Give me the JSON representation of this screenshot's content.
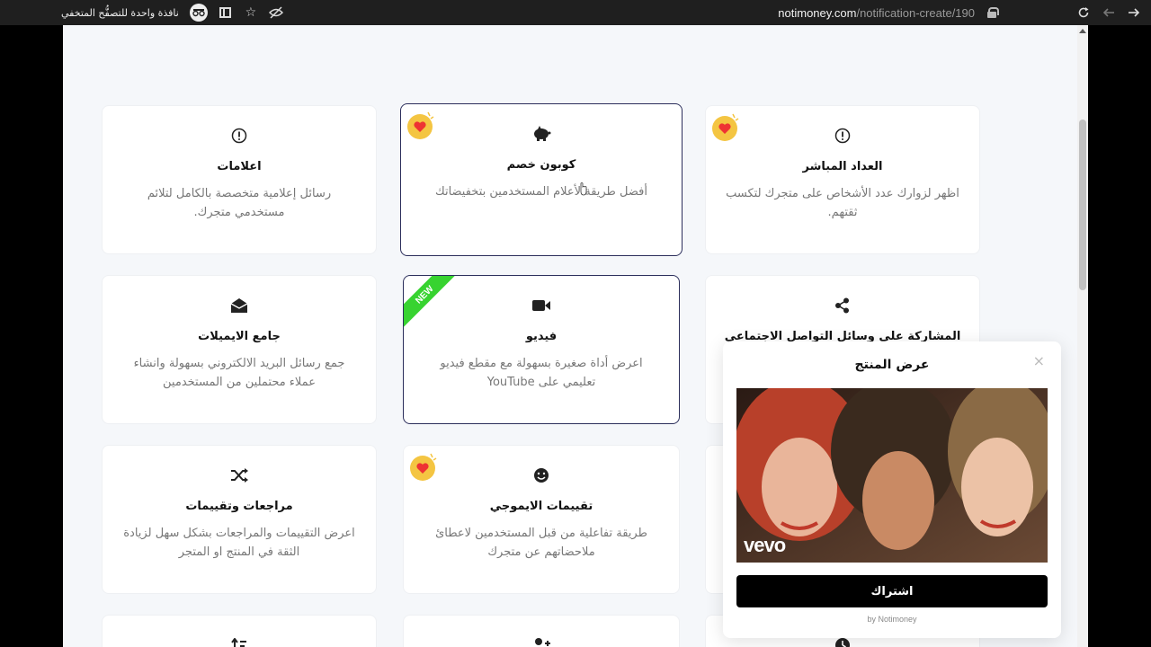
{
  "browser": {
    "url_domain": "notimoney.com",
    "url_path": "/notification-create/190",
    "incognito_label": "نافذة واحدة للتصفُّح المتخفي",
    "incognito_icon": "incognito-icon"
  },
  "cards": [
    {
      "title": "العداد المباشر",
      "desc": "اظهر لزوارك عدد الأشخاص على متجرك لتكسب ثقتهم.",
      "icon": "exclamation-circle-icon",
      "badge": "heart"
    },
    {
      "title": "كوبون خصم",
      "desc": "أفضل طريقة لأعلام المستخدمين بتخفيضاتك",
      "icon": "piggy-bank-icon",
      "badge": "heart",
      "selected": true
    },
    {
      "title": "اعلامات",
      "desc": "رسائل إعلامية متخصصة بالكامل لتلائم مستخدمي متجرك.",
      "icon": "exclamation-circle-icon"
    },
    {
      "title": "المشاركة على وسائل التواصل الاجتماعي",
      "desc": "",
      "icon": "share-icon"
    },
    {
      "title": "فيديو",
      "desc": "اعرض أداة صغيرة بسهولة مع مقطع فيديو تعليمي على YouTube",
      "icon": "video-icon",
      "badge": "new",
      "badge_text": "NEW",
      "selected": true
    },
    {
      "title": "جامع الايميلات",
      "desc": "جمع رسائل البريد الالكتروني بسهولة وانشاء عملاء محتملين من المستخدمين",
      "icon": "envelope-open-icon"
    },
    {
      "title": "تقييمات الايموجي",
      "desc": "طريقة تفاعلية من قبل المستخدمين لاعطائ ملاحضاتهم عن متجرك",
      "icon": "smile-icon",
      "badge": "heart"
    },
    {
      "title": "مراجعات وتقييمات",
      "desc": "اعرض التقييمات والمراجعات بشكل سهل لزيادة الثقة في المنتج او المتجر",
      "icon": "shuffle-icon"
    }
  ],
  "popup": {
    "title": "عرض المنتج",
    "close_label": "×",
    "video_logo": "vevo",
    "button_label": "اشتراك",
    "footer": "by Notimoney"
  }
}
